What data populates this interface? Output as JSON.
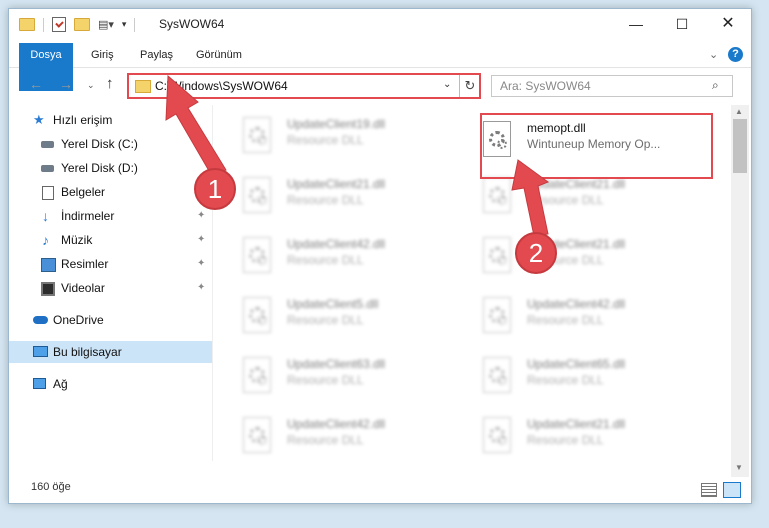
{
  "window": {
    "title": "SysWOW64",
    "minimize": "—",
    "maximize": "☐",
    "close": "✕"
  },
  "ribbon": {
    "tabs": [
      "Dosya",
      "Giriş",
      "Paylaş",
      "Görünüm"
    ],
    "expand": "⌄",
    "help": "?"
  },
  "navigation": {
    "back": "←",
    "forward": "→",
    "recent": "⌄",
    "up": "↑",
    "address": "C:\\Windows\\SysWOW64",
    "address_dropdown": "⌄",
    "refresh": "↻",
    "search_placeholder": "Ara: SysWOW64",
    "search_icon": "⌕"
  },
  "sidebar": {
    "items": [
      {
        "label": "Hızlı erişim",
        "icon": "star-icon"
      },
      {
        "label": "Yerel Disk (C:)",
        "icon": "drive-icon",
        "pinned": true
      },
      {
        "label": "Yerel Disk (D:)",
        "icon": "drive-icon"
      },
      {
        "label": "Belgeler",
        "icon": "documents-icon"
      },
      {
        "label": "İndirmeler",
        "icon": "downloads-icon",
        "pinned": true
      },
      {
        "label": "Müzik",
        "icon": "music-icon",
        "pinned": true
      },
      {
        "label": "Resimler",
        "icon": "pictures-icon",
        "pinned": true
      },
      {
        "label": "Videolar",
        "icon": "videos-icon",
        "pinned": true
      },
      {
        "label": "OneDrive",
        "icon": "onedrive-icon"
      },
      {
        "label": "Bu bilgisayar",
        "icon": "this-pc-icon",
        "selected": true
      },
      {
        "label": "Ağ",
        "icon": "network-icon"
      }
    ],
    "pin_glyph": "📌"
  },
  "files": {
    "left": [
      {
        "name": "UpdateClient19.dll",
        "desc": "Resource DLL"
      },
      {
        "name": "UpdateClient21.dll",
        "desc": "Resource DLL"
      },
      {
        "name": "UpdateClient42.dll",
        "desc": "Resource DLL"
      },
      {
        "name": "UpdateClient5.dll",
        "desc": "Resource DLL"
      },
      {
        "name": "UpdateClient63.dll",
        "desc": "Resource DLL"
      },
      {
        "name": "UpdateClient42.dll",
        "desc": "Resource DLL"
      }
    ],
    "right": [
      {
        "name": "memopt.dll",
        "desc": "Wintuneup Memory Op...",
        "highlight": true
      },
      {
        "name": "UpdateClient21.dll",
        "desc": "Resource DLL"
      },
      {
        "name": "UpdateClient21.dll",
        "desc": "Resource DLL"
      },
      {
        "name": "UpdateClient42.dll",
        "desc": "Resource DLL"
      },
      {
        "name": "UpdateClient65.dll",
        "desc": "Resource DLL"
      },
      {
        "name": "UpdateClient21.dll",
        "desc": "Resource DLL"
      }
    ]
  },
  "status": {
    "count": "160 öğe"
  },
  "annotations": {
    "step1": "1",
    "step2": "2",
    "color": "#e24a4f"
  }
}
